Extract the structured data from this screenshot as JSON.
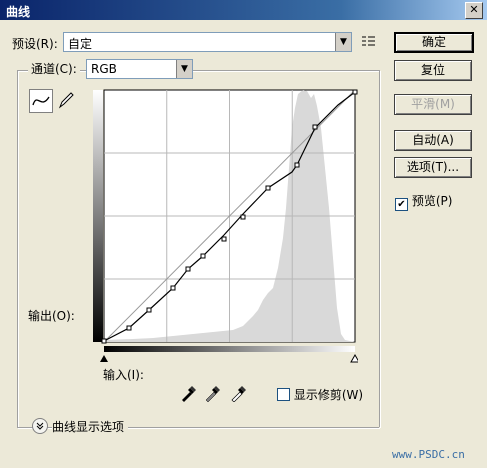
{
  "window": {
    "title": "曲线",
    "close_icon": "close-icon"
  },
  "preset": {
    "label": "预设(R):",
    "value": "自定",
    "menu_icon": "preset-options-icon"
  },
  "channel": {
    "label": "通道(C):",
    "value": "RGB"
  },
  "buttons": {
    "ok": "确定",
    "reset": "复位",
    "smooth": "平滑(M)",
    "auto": "自动(A)",
    "options": "选项(T)..."
  },
  "preview": {
    "label": "预览(P)",
    "checked": true
  },
  "curve_tools": {
    "curve_icon": "curve-point-tool-icon",
    "pencil_icon": "pencil-icon"
  },
  "graph": {
    "output_label": "输出(O):",
    "input_label": "输入(I):"
  },
  "eyedroppers": [
    "black-point-eyedropper-icon",
    "gray-point-eyedropper-icon",
    "white-point-eyedropper-icon"
  ],
  "show_clipping": {
    "label": "显示修剪(W)",
    "checked": false
  },
  "curve_display_options": {
    "label": "曲线显示选项",
    "icon": "expand-chevron-icon"
  },
  "watermark": {
    "text": "www.PSDC.cn"
  },
  "colors": {
    "titlebar": "#0a246a",
    "dialog_bg": "#ece9d8",
    "curve": "#000000",
    "histogram": "#d9d9d9"
  }
}
